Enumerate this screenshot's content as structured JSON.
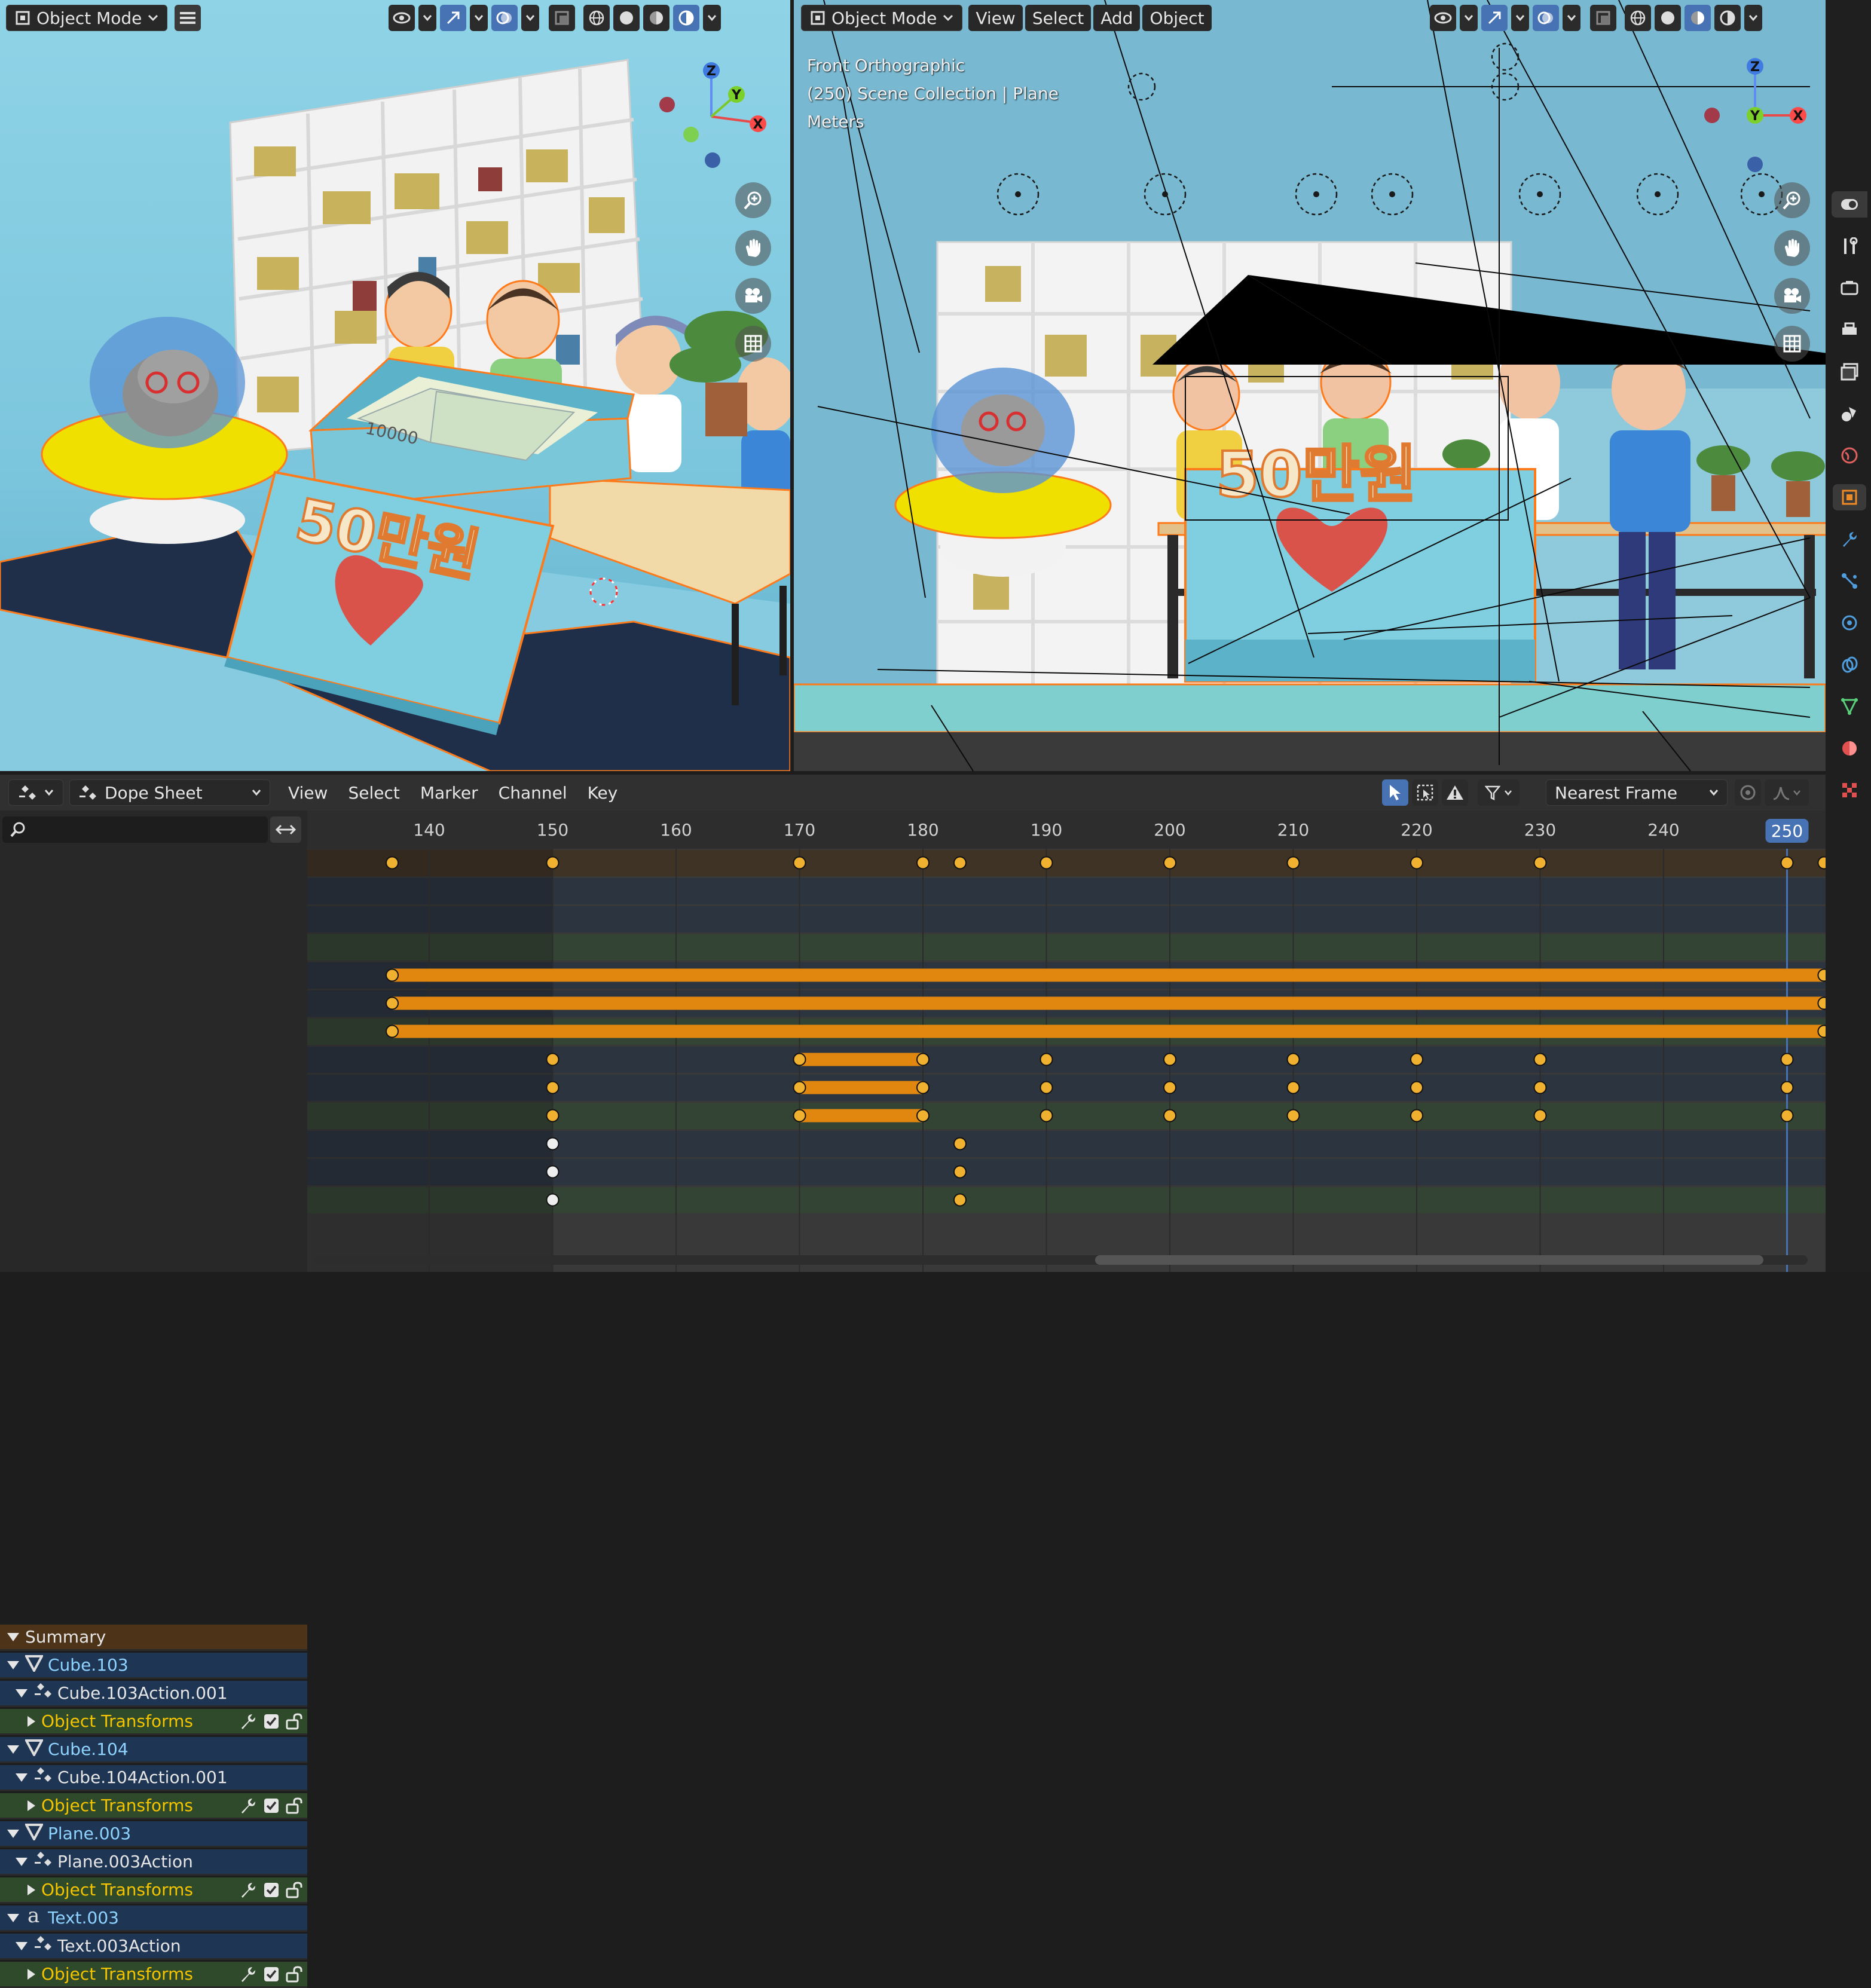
{
  "left_viewport": {
    "mode_label": "Object Mode",
    "scene_text": {
      "price_label": "50만원",
      "banknote": "10000"
    }
  },
  "right_viewport": {
    "mode_label": "Object Mode",
    "menus": [
      "View",
      "Select",
      "Add",
      "Object"
    ],
    "overlay": {
      "view_name": "Front Orthographic",
      "collection": "(250) Scene Collection | Plane",
      "units": "Meters"
    },
    "scene_text": {
      "price_label": "50만원"
    }
  },
  "gizmo": {
    "x": "X",
    "y": "Y",
    "z": "Z"
  },
  "dopesheet": {
    "editor_label": "Dope Sheet",
    "menus": [
      "View",
      "Select",
      "Marker",
      "Channel",
      "Key"
    ],
    "snap_mode": "Nearest Frame",
    "search_placeholder": "",
    "current_frame": "250",
    "frame_ticks": [
      "140",
      "150",
      "160",
      "170",
      "180",
      "190",
      "200",
      "210",
      "220",
      "230",
      "240"
    ],
    "channels": [
      {
        "label": "Summary",
        "kind": "summary"
      },
      {
        "label": "Cube.103",
        "kind": "object",
        "icon": "mesh-icon"
      },
      {
        "label": "Cube.103Action.001",
        "kind": "action"
      },
      {
        "label": "Object Transforms",
        "kind": "group"
      },
      {
        "label": "Cube.104",
        "kind": "object",
        "icon": "mesh-icon"
      },
      {
        "label": "Cube.104Action.001",
        "kind": "action"
      },
      {
        "label": "Object Transforms",
        "kind": "group"
      },
      {
        "label": "Plane.003",
        "kind": "object",
        "icon": "mesh-icon"
      },
      {
        "label": "Plane.003Action",
        "kind": "action"
      },
      {
        "label": "Object Transforms",
        "kind": "group"
      },
      {
        "label": "Text.003",
        "kind": "object",
        "icon": "text-icon"
      },
      {
        "label": "Text.003Action",
        "kind": "action"
      },
      {
        "label": "Object Transforms",
        "kind": "group"
      }
    ],
    "keyframes": {
      "summary": [
        137,
        150,
        170,
        180,
        183,
        190,
        200,
        210,
        220,
        230,
        250,
        253
      ],
      "cube103": [],
      "cube104": [
        137,
        253
      ],
      "plane003": [
        150,
        170,
        180,
        190,
        200,
        210,
        220,
        230,
        250
      ],
      "text003": [
        150,
        183
      ]
    },
    "hold_bars": {
      "cube104": [
        [
          137,
          253
        ]
      ],
      "plane003": [
        [
          170,
          180
        ]
      ]
    }
  },
  "colors": {
    "accent_blue": "#4772b3",
    "keyframe": "#f0b030",
    "hold_bar": "#e1870f",
    "summary_row": "#4d3418",
    "object_row": "#1f3554",
    "group_row": "#2f4a2a",
    "group_text": "#f5c400"
  }
}
